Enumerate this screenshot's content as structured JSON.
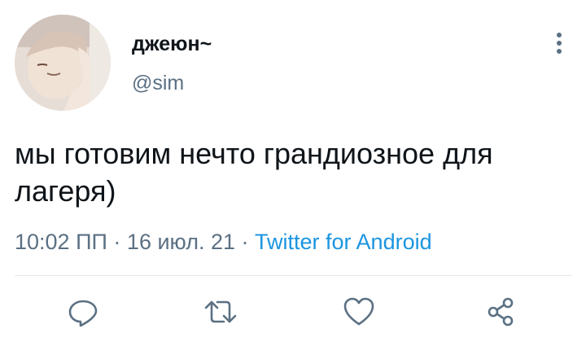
{
  "author": {
    "display_name": "джеюн~",
    "handle": "@sim"
  },
  "tweet": {
    "text": "мы готовим нечто грандиозное для лагеря)",
    "time": "10:02 ПП",
    "separator": "·",
    "date": "16 июл. 21",
    "source": "Twitter for Android"
  },
  "icons": {
    "more": "more-vertical-icon",
    "reply": "reply-icon",
    "retweet": "retweet-icon",
    "like": "like-icon",
    "share": "share-icon"
  },
  "colors": {
    "text": "#0f1419",
    "secondary": "#5b7083",
    "link": "#1b95e0",
    "divider": "#e1e8ed"
  }
}
